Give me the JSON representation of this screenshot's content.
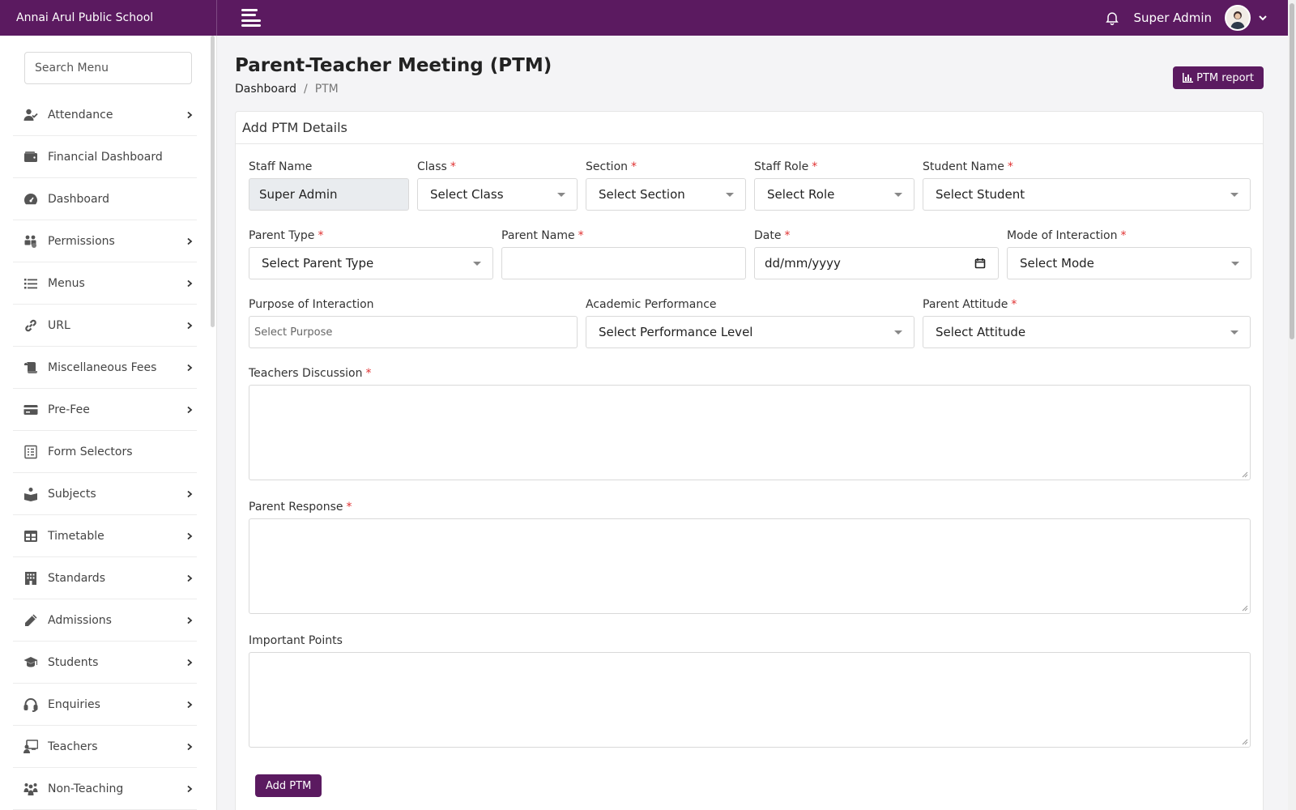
{
  "app": {
    "school_name": "Annai Arul Public School"
  },
  "header": {
    "user_name": "Super Admin"
  },
  "sidebar": {
    "search_placeholder": "Search Menu",
    "items": [
      {
        "label": "Attendance",
        "icon": "user-check-icon",
        "has_children": true
      },
      {
        "label": "Financial Dashboard",
        "icon": "wallet-icon",
        "has_children": false
      },
      {
        "label": "Dashboard",
        "icon": "gauge-icon",
        "has_children": false
      },
      {
        "label": "Permissions",
        "icon": "users-gear-icon",
        "has_children": true
      },
      {
        "label": "Menus",
        "icon": "list-icon",
        "has_children": true
      },
      {
        "label": "URL",
        "icon": "link-icon",
        "has_children": true
      },
      {
        "label": "Miscellaneous Fees",
        "icon": "scroll-icon",
        "has_children": true
      },
      {
        "label": "Pre-Fee",
        "icon": "credit-card-icon",
        "has_children": true
      },
      {
        "label": "Form Selectors",
        "icon": "form-icon",
        "has_children": false
      },
      {
        "label": "Subjects",
        "icon": "book-reader-icon",
        "has_children": true
      },
      {
        "label": "Timetable",
        "icon": "table-icon",
        "has_children": true
      },
      {
        "label": "Standards",
        "icon": "building-icon",
        "has_children": true
      },
      {
        "label": "Admissions",
        "icon": "pencil-icon",
        "has_children": true
      },
      {
        "label": "Students",
        "icon": "graduation-cap-icon",
        "has_children": true
      },
      {
        "label": "Enquiries",
        "icon": "headset-icon",
        "has_children": true
      },
      {
        "label": "Teachers",
        "icon": "chalkboard-teacher-icon",
        "has_children": true
      },
      {
        "label": "Non-Teaching",
        "icon": "people-group-icon",
        "has_children": true
      }
    ]
  },
  "page": {
    "title": "Parent-Teacher Meeting (PTM)",
    "breadcrumb": {
      "home": "Dashboard",
      "separator": "/",
      "current": "PTM"
    },
    "report_button": "PTM report"
  },
  "form": {
    "card_title": "Add PTM Details",
    "staff_name": {
      "label": "Staff Name",
      "value": "Super Admin"
    },
    "class": {
      "label": "Class",
      "selected": "Select Class"
    },
    "section": {
      "label": "Section",
      "selected": "Select Section"
    },
    "staff_role": {
      "label": "Staff Role",
      "selected": "Select Role"
    },
    "student_name": {
      "label": "Student Name",
      "selected": "Select Student"
    },
    "parent_type": {
      "label": "Parent Type",
      "selected": "Select Parent Type"
    },
    "parent_name": {
      "label": "Parent Name",
      "value": ""
    },
    "date": {
      "label": "Date",
      "placeholder": "dd/mm/yyyy"
    },
    "mode": {
      "label": "Mode of Interaction",
      "selected": "Select Mode"
    },
    "purpose": {
      "label": "Purpose of Interaction",
      "placeholder": "Select Purpose"
    },
    "academic": {
      "label": "Academic Performance",
      "selected": "Select Performance Level"
    },
    "attitude": {
      "label": "Parent Attitude",
      "selected": "Select Attitude"
    },
    "teachers_discussion": {
      "label": "Teachers Discussion"
    },
    "parent_response": {
      "label": "Parent Response"
    },
    "important_points": {
      "label": "Important Points"
    },
    "submit_label": "Add PTM",
    "required_marker": "*"
  },
  "colors": {
    "brand": "#5b1a60",
    "required": "#e03131"
  }
}
